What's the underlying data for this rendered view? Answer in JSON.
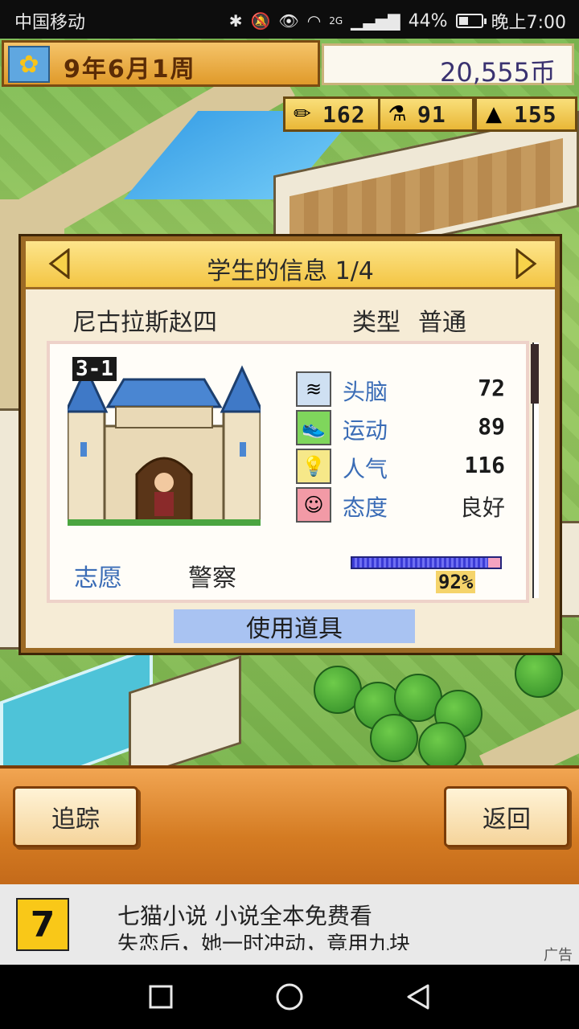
{
  "status_bar": {
    "carrier": "中国移动",
    "network": "2G",
    "battery": "44%",
    "battery_level": 0.44,
    "time": "晚上7:00",
    "icons": [
      "bluetooth-icon",
      "mute-icon",
      "eye-icon",
      "wifi-icon",
      "signal-icon",
      "battery-icon"
    ]
  },
  "hud": {
    "date": "9年6月1周",
    "money": "20,555币",
    "stats": [
      {
        "icon": "pencil-icon",
        "value": "162"
      },
      {
        "icon": "flask-icon",
        "value": "91"
      },
      {
        "icon": "tower-icon",
        "value": "155"
      }
    ]
  },
  "dialog": {
    "title": "学生的信息 1/4",
    "student_name": "尼古拉斯赵四",
    "type_label": "类型",
    "type_value": "普通",
    "classroom": "3-1",
    "stats": [
      {
        "icon": "brain-icon",
        "label": "头脑",
        "value": "72"
      },
      {
        "icon": "sneaker-icon",
        "label": "运动",
        "value": "89"
      },
      {
        "icon": "lightbulb-icon",
        "label": "人气",
        "value": "116"
      },
      {
        "icon": "smiley-icon",
        "label": "态度",
        "value": "良好"
      }
    ],
    "wish_label": "志愿",
    "wish_value": "警察",
    "wish_progress": 0.92,
    "wish_progress_text": "92%",
    "use_item_label": "使用道具"
  },
  "bottom": {
    "track_label": "追踪",
    "back_label": "返回"
  },
  "ad": {
    "logo": "7",
    "line1": "七猫小说    小说全本免费看",
    "line2": "失恋后，她一时冲动，竟用九块",
    "tag": "广告"
  },
  "colors": {
    "accent_blue": "#3a6cb6",
    "dialog_bg": "#f6ecd6",
    "title_gold": "#f3c543",
    "button_bar": "#d47b22"
  }
}
